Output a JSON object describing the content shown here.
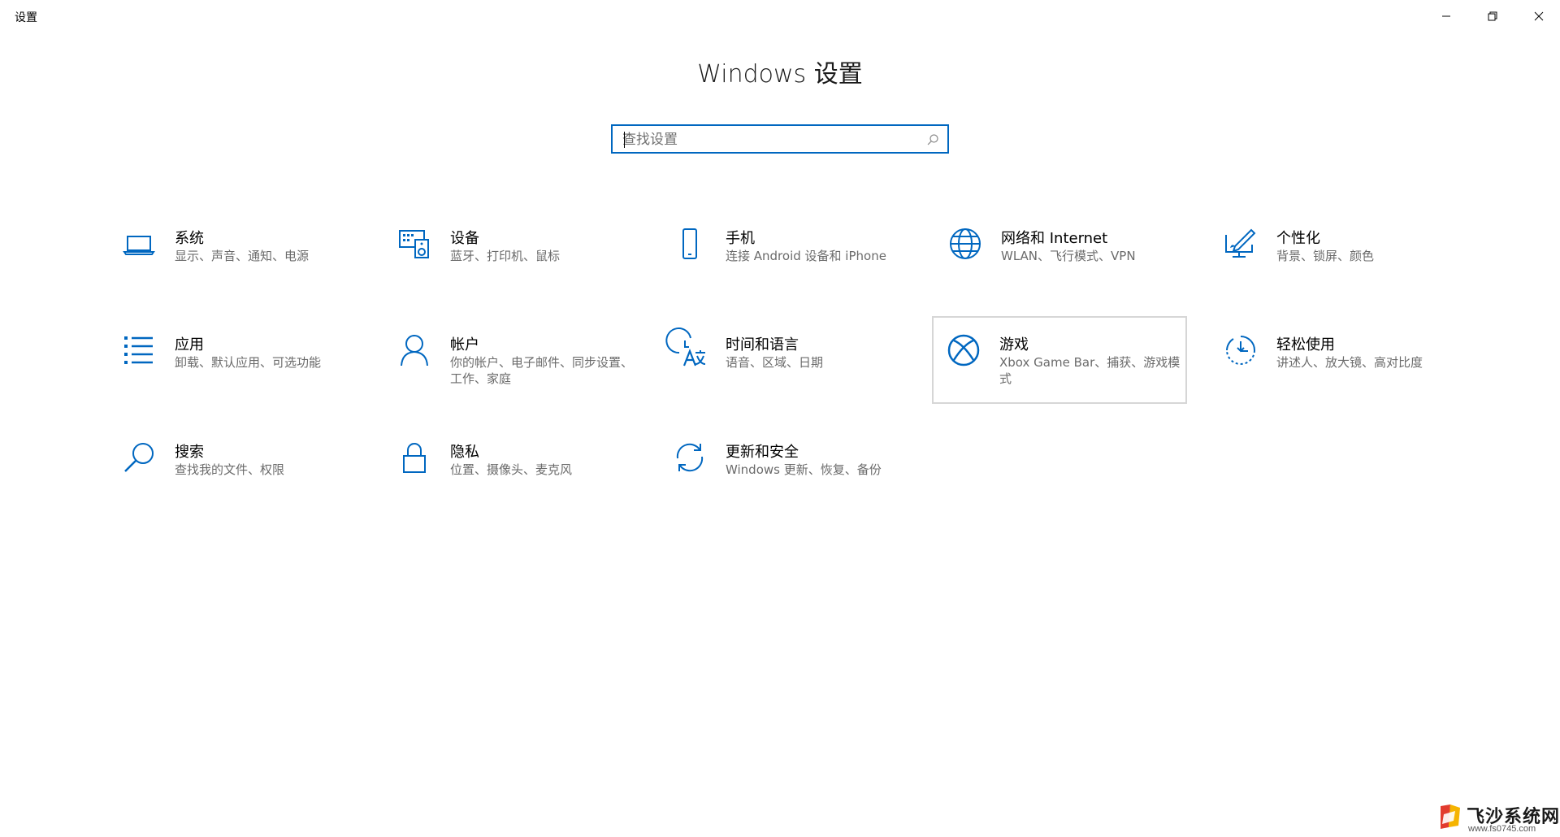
{
  "window": {
    "title": "设置"
  },
  "page": {
    "title": "Windows 设置"
  },
  "search": {
    "placeholder": "查找设置"
  },
  "tiles": [
    {
      "label": "系统",
      "desc": "显示、声音、通知、电源",
      "icon": "laptop-icon"
    },
    {
      "label": "设备",
      "desc": "蓝牙、打印机、鼠标",
      "icon": "keyboard-speaker-icon"
    },
    {
      "label": "手机",
      "desc": "连接 Android 设备和 iPhone",
      "icon": "phone-icon"
    },
    {
      "label": "网络和 Internet",
      "desc": "WLAN、飞行模式、VPN",
      "icon": "globe-icon"
    },
    {
      "label": "个性化",
      "desc": "背景、锁屏、颜色",
      "icon": "pen-tablet-icon"
    },
    {
      "label": "应用",
      "desc": "卸载、默认应用、可选功能",
      "icon": "apps-list-icon"
    },
    {
      "label": "帐户",
      "desc": "你的帐户、电子邮件、同步设置、工作、家庭",
      "icon": "person-icon"
    },
    {
      "label": "时间和语言",
      "desc": "语音、区域、日期",
      "icon": "time-language-icon"
    },
    {
      "label": "游戏",
      "desc": "Xbox Game Bar、捕获、游戏模式",
      "icon": "xbox-icon"
    },
    {
      "label": "轻松使用",
      "desc": "讲述人、放大镜、高对比度",
      "icon": "ease-of-access-icon"
    },
    {
      "label": "搜索",
      "desc": "查找我的文件、权限",
      "icon": "search-icon"
    },
    {
      "label": "隐私",
      "desc": "位置、摄像头、麦克风",
      "icon": "lock-icon"
    },
    {
      "label": "更新和安全",
      "desc": "Windows 更新、恢复、备份",
      "icon": "sync-icon"
    }
  ],
  "watermark": {
    "name": "飞沙系统网",
    "url": "www.fs0745.com"
  },
  "colors": {
    "accent": "#0067c0",
    "desc_text": "#6b6b6b",
    "hover_border": "#d6d6d6"
  }
}
